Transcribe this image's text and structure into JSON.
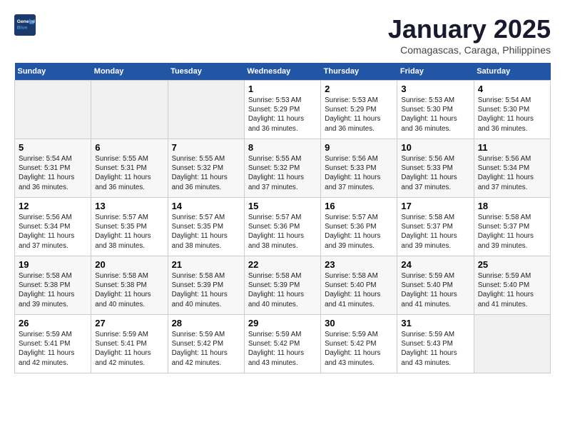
{
  "logo": {
    "line1": "General",
    "line2": "Blue"
  },
  "title": "January 2025",
  "subtitle": "Comagascas, Caraga, Philippines",
  "days_of_week": [
    "Sunday",
    "Monday",
    "Tuesday",
    "Wednesday",
    "Thursday",
    "Friday",
    "Saturday"
  ],
  "weeks": [
    [
      {
        "day": "",
        "info": ""
      },
      {
        "day": "",
        "info": ""
      },
      {
        "day": "",
        "info": ""
      },
      {
        "day": "1",
        "info": "Sunrise: 5:53 AM\nSunset: 5:29 PM\nDaylight: 11 hours\nand 36 minutes."
      },
      {
        "day": "2",
        "info": "Sunrise: 5:53 AM\nSunset: 5:29 PM\nDaylight: 11 hours\nand 36 minutes."
      },
      {
        "day": "3",
        "info": "Sunrise: 5:53 AM\nSunset: 5:30 PM\nDaylight: 11 hours\nand 36 minutes."
      },
      {
        "day": "4",
        "info": "Sunrise: 5:54 AM\nSunset: 5:30 PM\nDaylight: 11 hours\nand 36 minutes."
      }
    ],
    [
      {
        "day": "5",
        "info": "Sunrise: 5:54 AM\nSunset: 5:31 PM\nDaylight: 11 hours\nand 36 minutes."
      },
      {
        "day": "6",
        "info": "Sunrise: 5:55 AM\nSunset: 5:31 PM\nDaylight: 11 hours\nand 36 minutes."
      },
      {
        "day": "7",
        "info": "Sunrise: 5:55 AM\nSunset: 5:32 PM\nDaylight: 11 hours\nand 36 minutes."
      },
      {
        "day": "8",
        "info": "Sunrise: 5:55 AM\nSunset: 5:32 PM\nDaylight: 11 hours\nand 37 minutes."
      },
      {
        "day": "9",
        "info": "Sunrise: 5:56 AM\nSunset: 5:33 PM\nDaylight: 11 hours\nand 37 minutes."
      },
      {
        "day": "10",
        "info": "Sunrise: 5:56 AM\nSunset: 5:33 PM\nDaylight: 11 hours\nand 37 minutes."
      },
      {
        "day": "11",
        "info": "Sunrise: 5:56 AM\nSunset: 5:34 PM\nDaylight: 11 hours\nand 37 minutes."
      }
    ],
    [
      {
        "day": "12",
        "info": "Sunrise: 5:56 AM\nSunset: 5:34 PM\nDaylight: 11 hours\nand 37 minutes."
      },
      {
        "day": "13",
        "info": "Sunrise: 5:57 AM\nSunset: 5:35 PM\nDaylight: 11 hours\nand 38 minutes."
      },
      {
        "day": "14",
        "info": "Sunrise: 5:57 AM\nSunset: 5:35 PM\nDaylight: 11 hours\nand 38 minutes."
      },
      {
        "day": "15",
        "info": "Sunrise: 5:57 AM\nSunset: 5:36 PM\nDaylight: 11 hours\nand 38 minutes."
      },
      {
        "day": "16",
        "info": "Sunrise: 5:57 AM\nSunset: 5:36 PM\nDaylight: 11 hours\nand 39 minutes."
      },
      {
        "day": "17",
        "info": "Sunrise: 5:58 AM\nSunset: 5:37 PM\nDaylight: 11 hours\nand 39 minutes."
      },
      {
        "day": "18",
        "info": "Sunrise: 5:58 AM\nSunset: 5:37 PM\nDaylight: 11 hours\nand 39 minutes."
      }
    ],
    [
      {
        "day": "19",
        "info": "Sunrise: 5:58 AM\nSunset: 5:38 PM\nDaylight: 11 hours\nand 39 minutes."
      },
      {
        "day": "20",
        "info": "Sunrise: 5:58 AM\nSunset: 5:38 PM\nDaylight: 11 hours\nand 40 minutes."
      },
      {
        "day": "21",
        "info": "Sunrise: 5:58 AM\nSunset: 5:39 PM\nDaylight: 11 hours\nand 40 minutes."
      },
      {
        "day": "22",
        "info": "Sunrise: 5:58 AM\nSunset: 5:39 PM\nDaylight: 11 hours\nand 40 minutes."
      },
      {
        "day": "23",
        "info": "Sunrise: 5:58 AM\nSunset: 5:40 PM\nDaylight: 11 hours\nand 41 minutes."
      },
      {
        "day": "24",
        "info": "Sunrise: 5:59 AM\nSunset: 5:40 PM\nDaylight: 11 hours\nand 41 minutes."
      },
      {
        "day": "25",
        "info": "Sunrise: 5:59 AM\nSunset: 5:40 PM\nDaylight: 11 hours\nand 41 minutes."
      }
    ],
    [
      {
        "day": "26",
        "info": "Sunrise: 5:59 AM\nSunset: 5:41 PM\nDaylight: 11 hours\nand 42 minutes."
      },
      {
        "day": "27",
        "info": "Sunrise: 5:59 AM\nSunset: 5:41 PM\nDaylight: 11 hours\nand 42 minutes."
      },
      {
        "day": "28",
        "info": "Sunrise: 5:59 AM\nSunset: 5:42 PM\nDaylight: 11 hours\nand 42 minutes."
      },
      {
        "day": "29",
        "info": "Sunrise: 5:59 AM\nSunset: 5:42 PM\nDaylight: 11 hours\nand 43 minutes."
      },
      {
        "day": "30",
        "info": "Sunrise: 5:59 AM\nSunset: 5:42 PM\nDaylight: 11 hours\nand 43 minutes."
      },
      {
        "day": "31",
        "info": "Sunrise: 5:59 AM\nSunset: 5:43 PM\nDaylight: 11 hours\nand 43 minutes."
      },
      {
        "day": "",
        "info": ""
      }
    ]
  ]
}
